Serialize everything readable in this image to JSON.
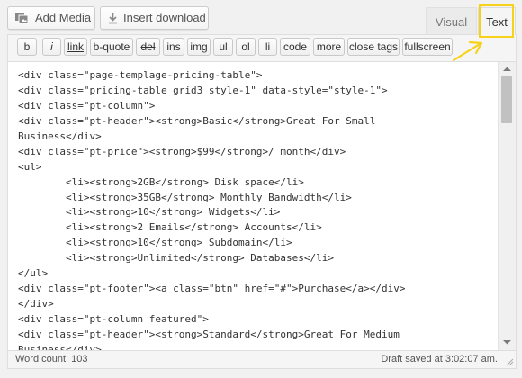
{
  "media_buttons": {
    "add_media": "Add Media",
    "insert_download": "Insert download"
  },
  "tabs": {
    "visual": "Visual",
    "text": "Text"
  },
  "quicktags": [
    "b",
    "i",
    "link",
    "b-quote",
    "del",
    "ins",
    "img",
    "ul",
    "ol",
    "li",
    "code",
    "more",
    "close tags",
    "fullscreen"
  ],
  "code_lines": [
    "<div class=\"page-templage-pricing-table\">",
    "<div class=\"pricing-table grid3 style-1\" data-style=\"style-1\">",
    "<div class=\"pt-column\">",
    "<div class=\"pt-header\"><strong>Basic</strong>Great For Small",
    "Business</div>",
    "<div class=\"pt-price\"><strong>$99</strong>/ month</div>",
    "<ul>",
    "        <li><strong>2GB</strong> Disk space</li>",
    "        <li><strong>35GB</strong> Monthly Bandwidth</li>",
    "        <li><strong>10</strong> Widgets</li>",
    "        <li><strong>2 Emails</strong> Accounts</li>",
    "        <li><strong>10</strong> Subdomain</li>",
    "        <li><strong>Unlimited</strong> Databases</li>",
    "</ul>",
    "<div class=\"pt-footer\"><a class=\"btn\" href=\"#\">Purchase</a></div>",
    "</div>",
    "<div class=\"pt-column featured\">",
    "<div class=\"pt-header\"><strong>Standard</strong>Great For Medium",
    "Business</div>"
  ],
  "status": {
    "word_count": "Word count: 103",
    "draft_saved": "Draft saved at 3:02:07 am."
  },
  "colors": {
    "highlight": "#f6d21a",
    "editor_background": "#ffffff",
    "page_background": "#f1f1f1"
  }
}
